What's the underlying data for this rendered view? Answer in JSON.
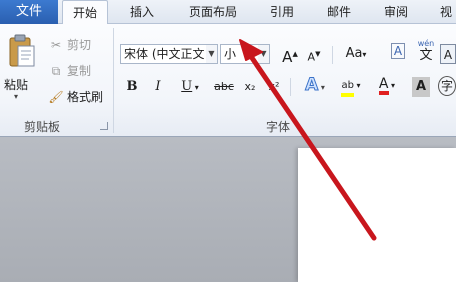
{
  "tabs": {
    "file": "文件",
    "home": "开始",
    "insert": "插入",
    "page_layout": "页面布局",
    "references": "引用",
    "mailings": "邮件",
    "review": "审阅",
    "view": "视"
  },
  "clipboard": {
    "paste": "粘贴",
    "cut": "剪切",
    "copy": "复制",
    "format_painter": "格式刷",
    "group_label": "剪贴板"
  },
  "font": {
    "family_value": "宋体 (中文正文",
    "size_value": "小",
    "grow": "A",
    "shrink": "A",
    "change_case": "Aa",
    "clear_format": "A",
    "phonetic": "wén",
    "bold": "B",
    "italic": "I",
    "underline": "U",
    "strike": "abc",
    "subscript": "x₂",
    "superscript": "x²",
    "text_effect": "A",
    "highlight": "ab",
    "font_color": "A",
    "char_shading": "A",
    "enclose": "字",
    "group_label": "字体"
  },
  "colors": {
    "accent_file_tab": "#2a5fb0",
    "annotation_arrow": "#c8161d",
    "highlight_yellow": "#ffff00",
    "font_red": "#e02020"
  }
}
